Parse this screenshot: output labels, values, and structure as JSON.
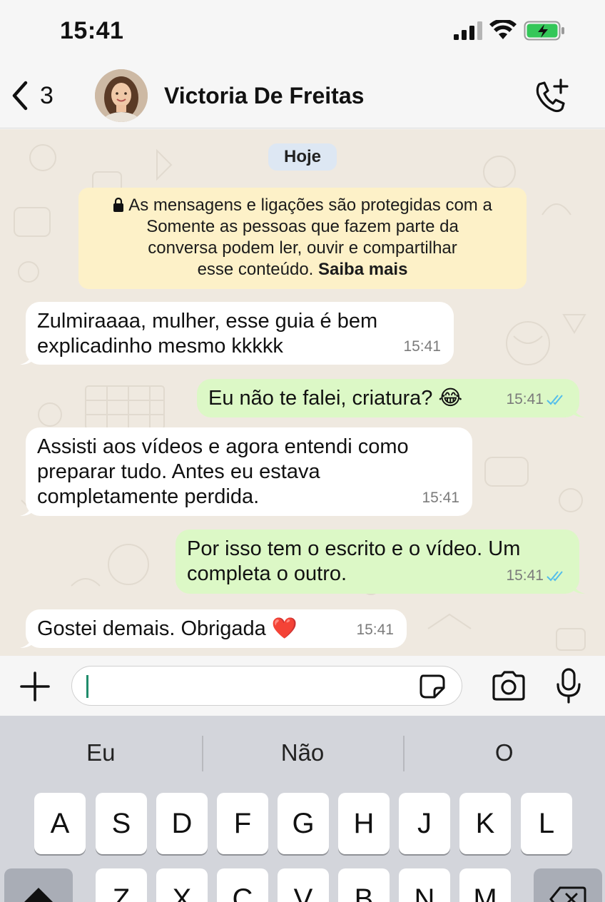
{
  "status_bar": {
    "time": "15:41"
  },
  "header": {
    "back_count": "3",
    "contact_name": "Victoria De Freitas"
  },
  "chat": {
    "date_pill": "Hoje",
    "notice": {
      "line1": "As mensagens e ligações são protegidas com a",
      "line2": "Somente as pessoas que fazem parte da",
      "line3": "conversa podem ler, ouvir e compartilhar",
      "line4_text": "esse conteúdo.",
      "link": "Saiba mais"
    },
    "messages": [
      {
        "dir": "in",
        "lines": [
          "Zulmiraaaa, mulher, esse guia é bem",
          "explicadinho mesmo kkkkk"
        ],
        "time": "15:41"
      },
      {
        "dir": "out",
        "text": "Eu não te falei, criatura? 😂",
        "time": "15:41"
      },
      {
        "dir": "in",
        "lines": [
          "Assisti aos vídeos e agora entendi como",
          "preparar tudo. Antes eu estava",
          "completamente perdida."
        ],
        "time": "15:41"
      },
      {
        "dir": "out",
        "lines": [
          "Por isso tem o escrito e o vídeo. Um",
          "completa o outro."
        ],
        "time": "15:41"
      },
      {
        "dir": "in",
        "text": "Gostei demais. Obrigada ❤️",
        "time": "15:41"
      }
    ]
  },
  "input": {
    "placeholder": ""
  },
  "keyboard": {
    "suggestions": [
      "Eu",
      "Não",
      "O"
    ],
    "row2": [
      "A",
      "S",
      "D",
      "F",
      "G",
      "H",
      "J",
      "K",
      "L"
    ],
    "row3": [
      "Z",
      "X",
      "C",
      "V",
      "B",
      "N",
      "M"
    ]
  },
  "colors": {
    "incoming_bubble": "#ffffff",
    "outgoing_bubble": "#dcf8c6",
    "chat_background": "#efe9e0",
    "notice_background": "#fdf1c8",
    "read_ticks": "#53bdeb",
    "battery_charging": "#34c759"
  }
}
